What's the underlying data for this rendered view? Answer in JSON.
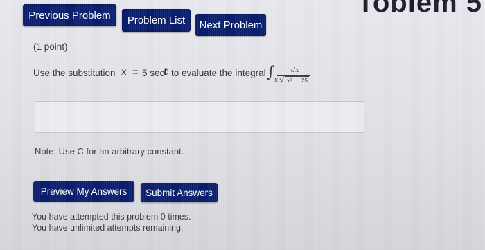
{
  "header": {
    "title_fragment": "Toblem 5"
  },
  "nav": {
    "previous_label": "Previous Problem",
    "list_label": "Problem List",
    "next_label": "Next Problem"
  },
  "problem": {
    "points": "(1 point)",
    "intro": "Use the substitution",
    "variable": "x",
    "equals": "=",
    "substitution": "5 sec",
    "sub_variable": "t",
    "middle": "to evaluate the integral",
    "integral_sign": "∫",
    "numerator": "dx",
    "denominator_x": "x",
    "denominator_root": "√",
    "denominator_inner": "x²",
    "denominator_const": "25"
  },
  "answer": {
    "value": ""
  },
  "note": "Note: Use C for an arbitrary constant.",
  "actions": {
    "preview_label": "Preview My Answers",
    "submit_label": "Submit Answers"
  },
  "attempts": {
    "line1": "You have attempted this problem 0 times.",
    "line2": "You have unlimited attempts remaining."
  }
}
